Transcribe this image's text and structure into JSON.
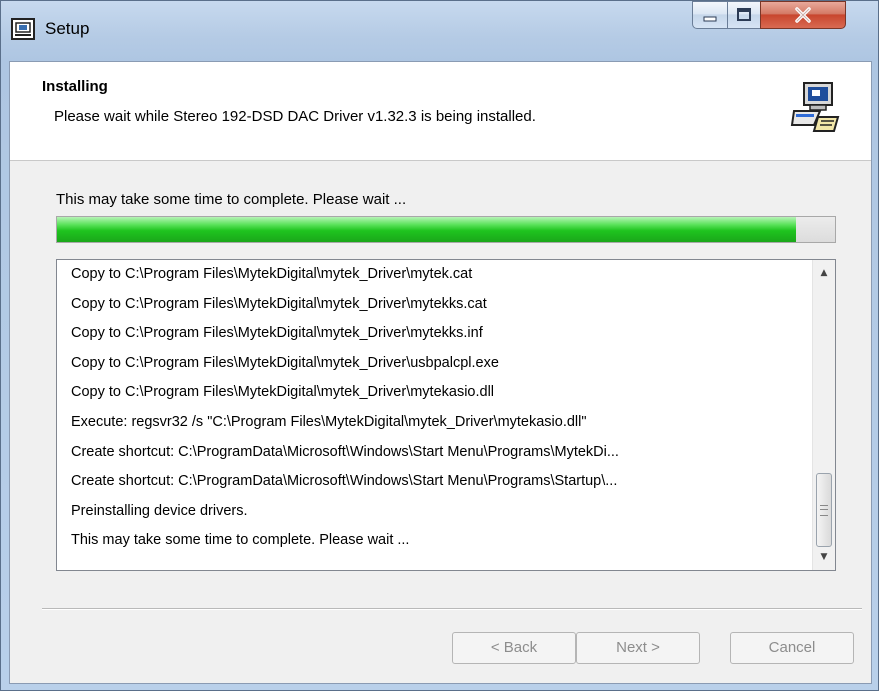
{
  "window": {
    "title": "Setup"
  },
  "header": {
    "title": "Installing",
    "subtitle": "Please wait while Stereo 192-DSD DAC Driver v1.32.3 is being installed."
  },
  "status": "This may take some time to complete. Please wait ...",
  "progress": {
    "fraction": 0.95
  },
  "log": [
    "Copy to C:\\Program Files\\MytekDigital\\mytek_Driver\\mytek.cat",
    "Copy to C:\\Program Files\\MytekDigital\\mytek_Driver\\mytekks.cat",
    "Copy to C:\\Program Files\\MytekDigital\\mytek_Driver\\mytekks.inf",
    "Copy to C:\\Program Files\\MytekDigital\\mytek_Driver\\usbpalcpl.exe",
    "Copy to C:\\Program Files\\MytekDigital\\mytek_Driver\\mytekasio.dll",
    "Execute: regsvr32 /s \"C:\\Program Files\\MytekDigital\\mytek_Driver\\mytekasio.dll\"",
    "Create shortcut: C:\\ProgramData\\Microsoft\\Windows\\Start Menu\\Programs\\MytekDi...",
    "Create shortcut: C:\\ProgramData\\Microsoft\\Windows\\Start Menu\\Programs\\Startup\\...",
    "Preinstalling device drivers.",
    "This may take some time to complete. Please wait ..."
  ],
  "buttons": {
    "back": "< Back",
    "next": "Next >",
    "cancel": "Cancel"
  },
  "icons": {
    "window": "setup-app-icon",
    "header": "computer-setup-icon",
    "minimize": "minimize-icon",
    "maximize": "maximize-icon",
    "close": "close-icon"
  },
  "colors": {
    "progress": "#1fc41f",
    "close": "#c8462e"
  }
}
